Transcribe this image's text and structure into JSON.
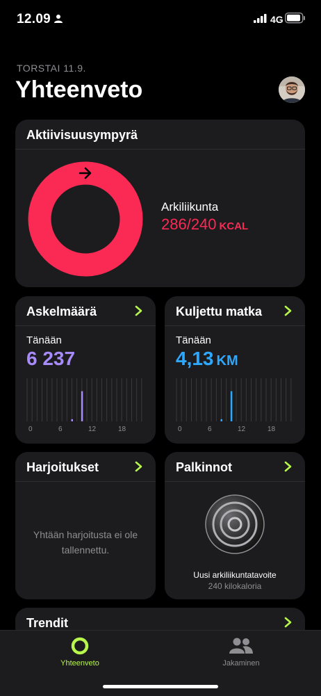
{
  "status": {
    "time": "12.09",
    "network": "4G"
  },
  "header": {
    "date": "TORSTAI 11.9.",
    "title": "Yhteenveto"
  },
  "activity": {
    "title": "Aktiivisuusympyrä",
    "move_label": "Arkiliikunta",
    "move_value": "286/240",
    "move_unit": "KCAL",
    "move_progress": 1.19,
    "color": "#fa2a55"
  },
  "steps": {
    "title": "Askelmäärä",
    "today_label": "Tänään",
    "value": "6 237",
    "color": "#a78bfa",
    "axis_ticks": [
      "0",
      "6",
      "12",
      "18"
    ],
    "hourly_fraction": [
      0,
      0,
      0,
      0,
      0,
      0,
      0,
      0,
      0,
      0.05,
      0,
      0.7,
      0,
      0,
      0,
      0,
      0,
      0,
      0,
      0,
      0,
      0,
      0,
      0
    ]
  },
  "distance": {
    "title": "Kuljettu matka",
    "today_label": "Tänään",
    "value": "4,13",
    "unit": "KM",
    "color": "#2ea8ff",
    "axis_ticks": [
      "0",
      "6",
      "12",
      "18"
    ],
    "hourly_fraction": [
      0,
      0,
      0,
      0,
      0,
      0,
      0,
      0,
      0,
      0.05,
      0,
      0.7,
      0,
      0,
      0,
      0,
      0,
      0,
      0,
      0,
      0,
      0,
      0,
      0
    ]
  },
  "workouts": {
    "title": "Harjoitukset",
    "empty_line1": "Yhtään harjoitusta ei ole",
    "empty_line2": "tallennettu."
  },
  "awards": {
    "title": "Palkinnot",
    "award_name": "Uusi arkiliikuntatavoite",
    "award_detail": "240 kilokaloria"
  },
  "trends": {
    "title": "Trendit"
  },
  "tabs": {
    "summary_label": "Yhteenveto",
    "sharing_label": "Jakaminen",
    "active_color": "#b6f64d"
  }
}
